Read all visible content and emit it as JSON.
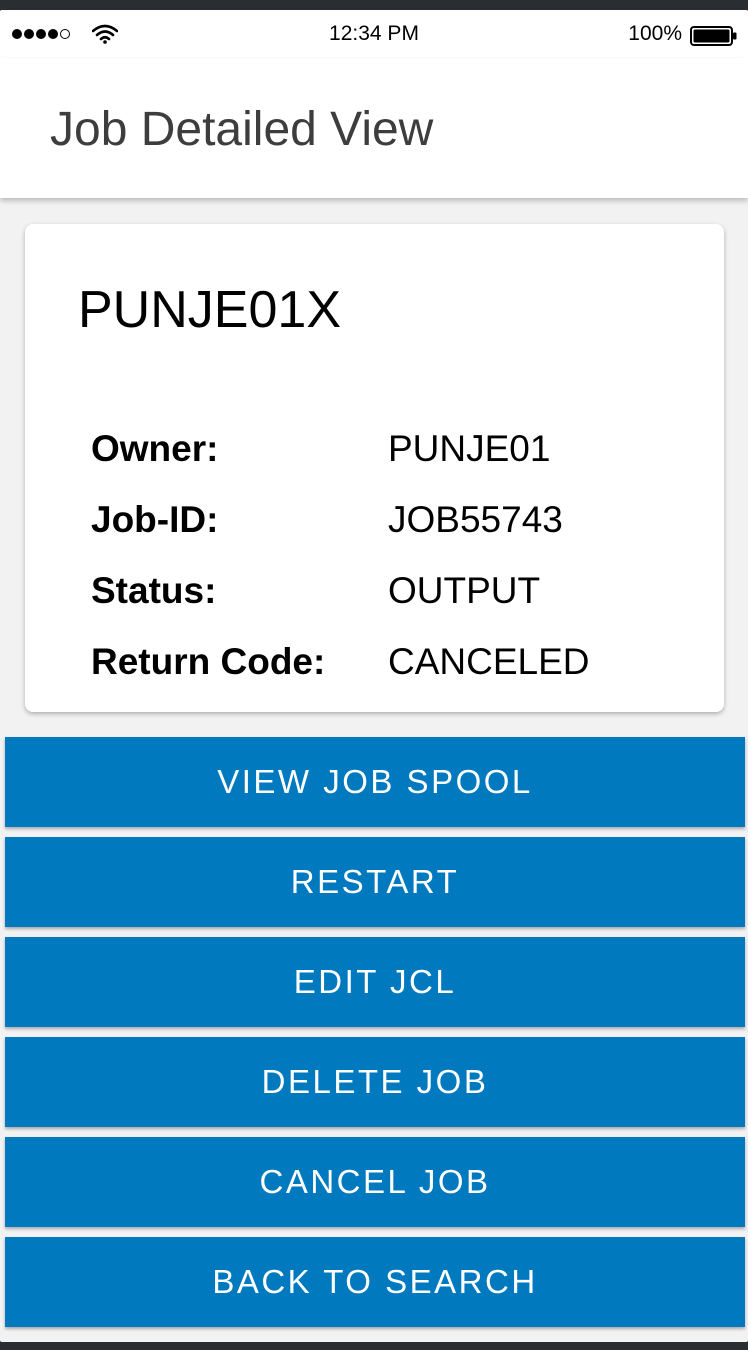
{
  "status_bar": {
    "time": "12:34 PM",
    "battery_percent": "100%",
    "signal_bars_filled": 4,
    "signal_bars_total": 5,
    "icons": [
      "signal-dots-icon",
      "wifi-icon",
      "battery-icon"
    ]
  },
  "header": {
    "title": "Job Detailed View"
  },
  "job": {
    "name": "PUNJE01X",
    "details": [
      {
        "label": "Owner:",
        "value": "PUNJE01"
      },
      {
        "label": "Job-ID:",
        "value": "JOB55743"
      },
      {
        "label": "Status:",
        "value": "OUTPUT"
      },
      {
        "label": "Return Code:",
        "value": "CANCELED"
      }
    ]
  },
  "actions": {
    "view_spool": "VIEW JOB SPOOL",
    "restart": "RESTART",
    "edit_jcl": "EDIT JCL",
    "delete_job": "DELETE JOB",
    "cancel_job": "CANCEL JOB",
    "back_to_search": "BACK TO SEARCH"
  },
  "colors": {
    "button_bg": "#0179bf",
    "button_text": "#ffffff",
    "page_bg": "#f2f2f2",
    "title_text": "#3d3d3d"
  }
}
